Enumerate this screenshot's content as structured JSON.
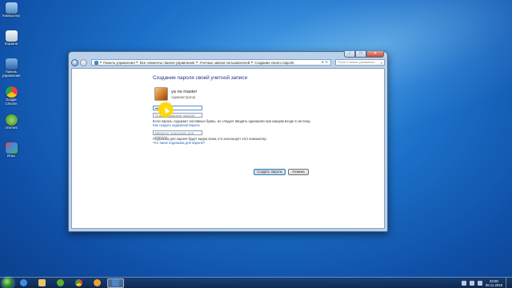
{
  "desktop": {
    "icons": [
      {
        "label": "Компьютер",
        "color": "#6fa8dc"
      },
      {
        "label": "Корзина",
        "color": "#dfe7ef"
      },
      {
        "label": "Панель управления",
        "color": "#4a86c8"
      },
      {
        "label": "Google Chrome",
        "color": "#e8453c"
      },
      {
        "label": "uTorrent",
        "color": "#5cb032"
      },
      {
        "label": "Игры",
        "color": "#c9c9c9"
      }
    ]
  },
  "window": {
    "controls": {
      "minimize": "‒",
      "maximize": "□",
      "close": "✕"
    },
    "breadcrumb": [
      "Панель управления",
      "Все элементы панели управления",
      "Учетные записи пользователей",
      "Создание своего пароля"
    ],
    "search_placeholder": "Поиск в панели управления",
    "heading": "Создание пароля своей учетной записи",
    "user": {
      "name": "ya ne master",
      "role": "Администратор"
    },
    "password_value": "•••••",
    "confirm_placeholder": "Подтверждение пароля",
    "info_text": "Если пароль содержит заглавные буквы, их следует вводить одинаково при каждом входе в систему.",
    "link_strong_password": "Как создать надежный пароль",
    "hint_placeholder": "Введите подсказку для пароля",
    "hint_text": "Подсказка для пароля будет видна всем, кто использует этот компьютер.",
    "link_hint": "Что такое подсказка для пароля?",
    "buttons": {
      "create": "Создать пароль",
      "cancel": "Отмена"
    }
  },
  "taskbar": {
    "items": [
      {
        "name": "taskbar-ie",
        "color": "#3a8ee6"
      },
      {
        "name": "taskbar-explorer",
        "color": "#e8c46a"
      },
      {
        "name": "taskbar-utorrent",
        "color": "#5cb032"
      },
      {
        "name": "taskbar-chrome",
        "color": "#e8453c"
      },
      {
        "name": "taskbar-media",
        "color": "#f0a030"
      },
      {
        "name": "taskbar-control-panel",
        "color": "#4a86c8"
      }
    ],
    "clock_time": "23:00",
    "clock_date": "06.11.2016"
  }
}
